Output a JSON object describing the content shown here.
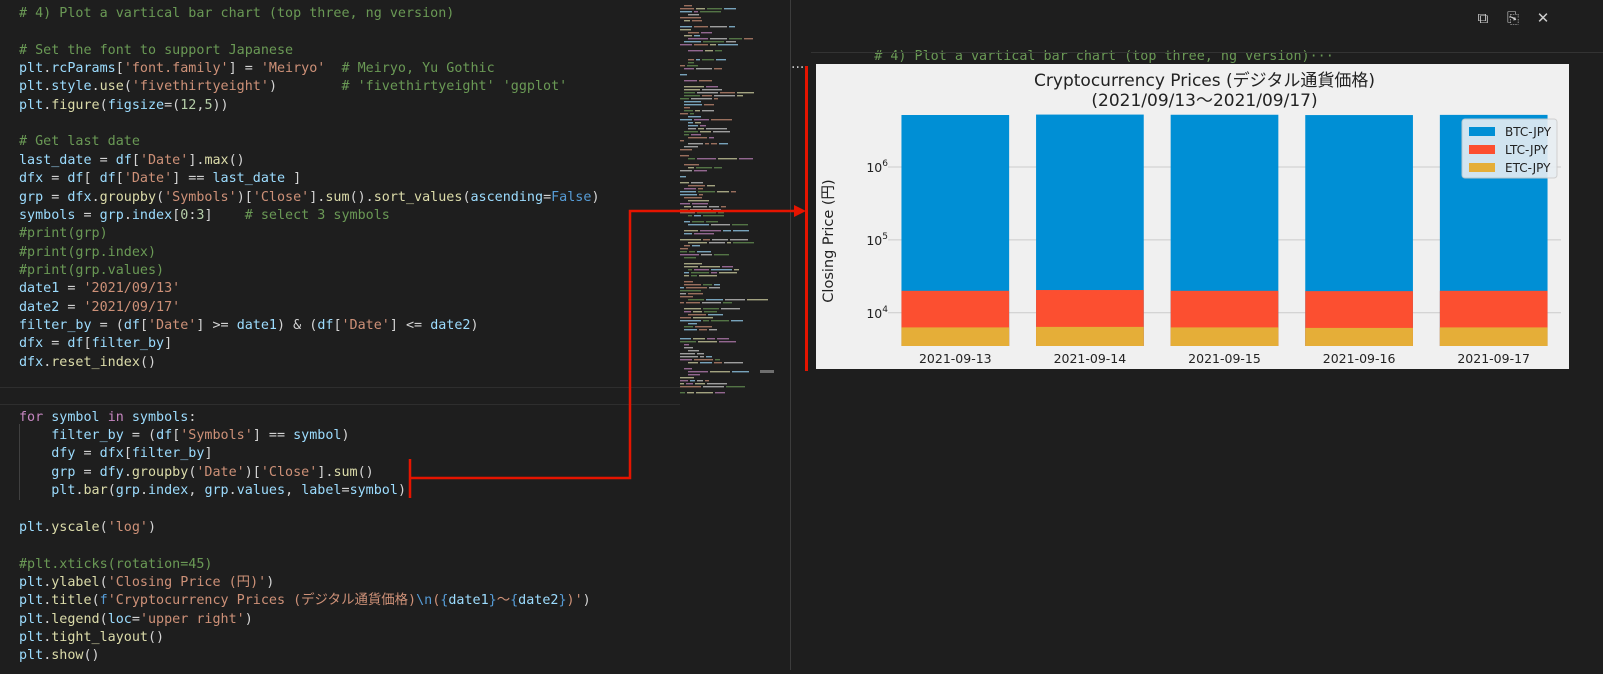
{
  "code_lines": [
    {
      "tokens": [
        {
          "t": "c",
          "x": "# 4) Plot a vartical bar chart (top three, ng version)"
        }
      ]
    },
    {
      "tokens": []
    },
    {
      "tokens": [
        {
          "t": "c",
          "x": "# Set the font to support Japanese"
        }
      ]
    },
    {
      "tokens": [
        {
          "t": "v",
          "x": "plt"
        },
        {
          "t": "p",
          "x": "."
        },
        {
          "t": "v",
          "x": "rcParams"
        },
        {
          "t": "p",
          "x": "["
        },
        {
          "t": "s",
          "x": "'font.family'"
        },
        {
          "t": "p",
          "x": "] = "
        },
        {
          "t": "s",
          "x": "'Meiryo'"
        },
        {
          "t": "p",
          "x": "  "
        },
        {
          "t": "c",
          "x": "# Meiryo, Yu Gothic"
        }
      ]
    },
    {
      "tokens": [
        {
          "t": "v",
          "x": "plt"
        },
        {
          "t": "p",
          "x": "."
        },
        {
          "t": "v",
          "x": "style"
        },
        {
          "t": "p",
          "x": "."
        },
        {
          "t": "f",
          "x": "use"
        },
        {
          "t": "p",
          "x": "("
        },
        {
          "t": "s",
          "x": "'fivethirtyeight'"
        },
        {
          "t": "p",
          "x": ")        "
        },
        {
          "t": "c",
          "x": "# 'fivethirtyeight' 'ggplot'"
        }
      ]
    },
    {
      "tokens": [
        {
          "t": "v",
          "x": "plt"
        },
        {
          "t": "p",
          "x": "."
        },
        {
          "t": "f",
          "x": "figure"
        },
        {
          "t": "p",
          "x": "("
        },
        {
          "t": "v",
          "x": "figsize"
        },
        {
          "t": "p",
          "x": "=("
        },
        {
          "t": "m",
          "x": "12"
        },
        {
          "t": "p",
          "x": ","
        },
        {
          "t": "m",
          "x": "5"
        },
        {
          "t": "p",
          "x": "))"
        }
      ]
    },
    {
      "tokens": []
    },
    {
      "tokens": [
        {
          "t": "c",
          "x": "# Get last date"
        }
      ]
    },
    {
      "tokens": [
        {
          "t": "v",
          "x": "last_date"
        },
        {
          "t": "p",
          "x": " = "
        },
        {
          "t": "v",
          "x": "df"
        },
        {
          "t": "p",
          "x": "["
        },
        {
          "t": "s",
          "x": "'Date'"
        },
        {
          "t": "p",
          "x": "]."
        },
        {
          "t": "f",
          "x": "max"
        },
        {
          "t": "p",
          "x": "()"
        }
      ]
    },
    {
      "tokens": [
        {
          "t": "v",
          "x": "dfx"
        },
        {
          "t": "p",
          "x": " = "
        },
        {
          "t": "v",
          "x": "df"
        },
        {
          "t": "p",
          "x": "[ "
        },
        {
          "t": "v",
          "x": "df"
        },
        {
          "t": "p",
          "x": "["
        },
        {
          "t": "s",
          "x": "'Date'"
        },
        {
          "t": "p",
          "x": "] == "
        },
        {
          "t": "v",
          "x": "last_date"
        },
        {
          "t": "p",
          "x": " ]"
        }
      ]
    },
    {
      "tokens": [
        {
          "t": "v",
          "x": "grp"
        },
        {
          "t": "p",
          "x": " = "
        },
        {
          "t": "v",
          "x": "dfx"
        },
        {
          "t": "p",
          "x": "."
        },
        {
          "t": "f",
          "x": "groupby"
        },
        {
          "t": "p",
          "x": "("
        },
        {
          "t": "s",
          "x": "'Symbols'"
        },
        {
          "t": "p",
          "x": ")["
        },
        {
          "t": "s",
          "x": "'Close'"
        },
        {
          "t": "p",
          "x": "]."
        },
        {
          "t": "f",
          "x": "sum"
        },
        {
          "t": "p",
          "x": "()."
        },
        {
          "t": "f",
          "x": "sort_values"
        },
        {
          "t": "p",
          "x": "("
        },
        {
          "t": "v",
          "x": "ascending"
        },
        {
          "t": "p",
          "x": "="
        },
        {
          "t": "n",
          "x": "False"
        },
        {
          "t": "p",
          "x": ")"
        }
      ]
    },
    {
      "tokens": [
        {
          "t": "v",
          "x": "symbols"
        },
        {
          "t": "p",
          "x": " = "
        },
        {
          "t": "v",
          "x": "grp"
        },
        {
          "t": "p",
          "x": "."
        },
        {
          "t": "v",
          "x": "index"
        },
        {
          "t": "p",
          "x": "["
        },
        {
          "t": "m",
          "x": "0"
        },
        {
          "t": "p",
          "x": ":"
        },
        {
          "t": "m",
          "x": "3"
        },
        {
          "t": "p",
          "x": "]    "
        },
        {
          "t": "c",
          "x": "# select 3 symbols"
        }
      ]
    },
    {
      "tokens": [
        {
          "t": "c",
          "x": "#print(grp)"
        }
      ]
    },
    {
      "tokens": [
        {
          "t": "c",
          "x": "#print(grp.index)"
        }
      ]
    },
    {
      "tokens": [
        {
          "t": "c",
          "x": "#print(grp.values)"
        }
      ]
    },
    {
      "tokens": [
        {
          "t": "v",
          "x": "date1"
        },
        {
          "t": "p",
          "x": " = "
        },
        {
          "t": "s",
          "x": "'2021/09/13'"
        }
      ]
    },
    {
      "tokens": [
        {
          "t": "v",
          "x": "date2"
        },
        {
          "t": "p",
          "x": " = "
        },
        {
          "t": "s",
          "x": "'2021/09/17'"
        }
      ]
    },
    {
      "tokens": [
        {
          "t": "v",
          "x": "filter_by"
        },
        {
          "t": "p",
          "x": " = ("
        },
        {
          "t": "v",
          "x": "df"
        },
        {
          "t": "p",
          "x": "["
        },
        {
          "t": "s",
          "x": "'Date'"
        },
        {
          "t": "p",
          "x": "] >= "
        },
        {
          "t": "v",
          "x": "date1"
        },
        {
          "t": "p",
          "x": ") & ("
        },
        {
          "t": "v",
          "x": "df"
        },
        {
          "t": "p",
          "x": "["
        },
        {
          "t": "s",
          "x": "'Date'"
        },
        {
          "t": "p",
          "x": "] <= "
        },
        {
          "t": "v",
          "x": "date2"
        },
        {
          "t": "p",
          "x": ")"
        }
      ]
    },
    {
      "tokens": [
        {
          "t": "v",
          "x": "dfx"
        },
        {
          "t": "p",
          "x": " = "
        },
        {
          "t": "v",
          "x": "df"
        },
        {
          "t": "p",
          "x": "["
        },
        {
          "t": "v",
          "x": "filter_by"
        },
        {
          "t": "p",
          "x": "]"
        }
      ]
    },
    {
      "tokens": [
        {
          "t": "v",
          "x": "dfx"
        },
        {
          "t": "p",
          "x": "."
        },
        {
          "t": "f",
          "x": "reset_index"
        },
        {
          "t": "p",
          "x": "()"
        }
      ]
    },
    {
      "tokens": []
    },
    {
      "tokens": []
    },
    {
      "tokens": [
        {
          "t": "k",
          "x": "for"
        },
        {
          "t": "p",
          "x": " "
        },
        {
          "t": "v",
          "x": "symbol"
        },
        {
          "t": "p",
          "x": " "
        },
        {
          "t": "k",
          "x": "in"
        },
        {
          "t": "p",
          "x": " "
        },
        {
          "t": "v",
          "x": "symbols"
        },
        {
          "t": "p",
          "x": ":"
        }
      ]
    },
    {
      "tokens": [
        {
          "t": "p",
          "x": "    "
        },
        {
          "t": "v",
          "x": "filter_by"
        },
        {
          "t": "p",
          "x": " = ("
        },
        {
          "t": "v",
          "x": "df"
        },
        {
          "t": "p",
          "x": "["
        },
        {
          "t": "s",
          "x": "'Symbols'"
        },
        {
          "t": "p",
          "x": "] == "
        },
        {
          "t": "v",
          "x": "symbol"
        },
        {
          "t": "p",
          "x": ")"
        }
      ]
    },
    {
      "tokens": [
        {
          "t": "p",
          "x": "    "
        },
        {
          "t": "v",
          "x": "dfy"
        },
        {
          "t": "p",
          "x": " = "
        },
        {
          "t": "v",
          "x": "dfx"
        },
        {
          "t": "p",
          "x": "["
        },
        {
          "t": "v",
          "x": "filter_by"
        },
        {
          "t": "p",
          "x": "]"
        }
      ]
    },
    {
      "tokens": [
        {
          "t": "p",
          "x": "    "
        },
        {
          "t": "v",
          "x": "grp"
        },
        {
          "t": "p",
          "x": " = "
        },
        {
          "t": "v",
          "x": "dfy"
        },
        {
          "t": "p",
          "x": "."
        },
        {
          "t": "f",
          "x": "groupby"
        },
        {
          "t": "p",
          "x": "("
        },
        {
          "t": "s",
          "x": "'Date'"
        },
        {
          "t": "p",
          "x": ")["
        },
        {
          "t": "s",
          "x": "'Close'"
        },
        {
          "t": "p",
          "x": "]."
        },
        {
          "t": "f",
          "x": "sum"
        },
        {
          "t": "p",
          "x": "()"
        }
      ]
    },
    {
      "tokens": [
        {
          "t": "p",
          "x": "    "
        },
        {
          "t": "v",
          "x": "plt"
        },
        {
          "t": "p",
          "x": "."
        },
        {
          "t": "f",
          "x": "bar"
        },
        {
          "t": "p",
          "x": "("
        },
        {
          "t": "v",
          "x": "grp"
        },
        {
          "t": "p",
          "x": "."
        },
        {
          "t": "v",
          "x": "index"
        },
        {
          "t": "p",
          "x": ", "
        },
        {
          "t": "v",
          "x": "grp"
        },
        {
          "t": "p",
          "x": "."
        },
        {
          "t": "v",
          "x": "values"
        },
        {
          "t": "p",
          "x": ", "
        },
        {
          "t": "v",
          "x": "label"
        },
        {
          "t": "p",
          "x": "="
        },
        {
          "t": "v",
          "x": "symbol"
        },
        {
          "t": "p",
          "x": ")"
        }
      ]
    },
    {
      "tokens": []
    },
    {
      "tokens": [
        {
          "t": "v",
          "x": "plt"
        },
        {
          "t": "p",
          "x": "."
        },
        {
          "t": "f",
          "x": "yscale"
        },
        {
          "t": "p",
          "x": "("
        },
        {
          "t": "s",
          "x": "'log'"
        },
        {
          "t": "p",
          "x": ")"
        }
      ]
    },
    {
      "tokens": []
    },
    {
      "tokens": [
        {
          "t": "c",
          "x": "#plt.xticks(rotation=45)"
        }
      ]
    },
    {
      "tokens": [
        {
          "t": "v",
          "x": "plt"
        },
        {
          "t": "p",
          "x": "."
        },
        {
          "t": "f",
          "x": "ylabel"
        },
        {
          "t": "p",
          "x": "("
        },
        {
          "t": "s",
          "x": "'Closing Price (円)'"
        },
        {
          "t": "p",
          "x": ")"
        }
      ]
    },
    {
      "tokens": [
        {
          "t": "v",
          "x": "plt"
        },
        {
          "t": "p",
          "x": "."
        },
        {
          "t": "f",
          "x": "title"
        },
        {
          "t": "p",
          "x": "("
        },
        {
          "t": "n",
          "x": "f"
        },
        {
          "t": "s",
          "x": "'Cryptocurrency Prices (デジタル通貨価格)"
        },
        {
          "t": "n",
          "x": "\\n"
        },
        {
          "t": "s",
          "x": "("
        },
        {
          "t": "n",
          "x": "{"
        },
        {
          "t": "v",
          "x": "date1"
        },
        {
          "t": "n",
          "x": "}"
        },
        {
          "t": "s",
          "x": "〜"
        },
        {
          "t": "n",
          "x": "{"
        },
        {
          "t": "v",
          "x": "date2"
        },
        {
          "t": "n",
          "x": "}"
        },
        {
          "t": "s",
          "x": ")'"
        },
        {
          "t": "p",
          "x": ")"
        }
      ]
    },
    {
      "tokens": [
        {
          "t": "v",
          "x": "plt"
        },
        {
          "t": "p",
          "x": "."
        },
        {
          "t": "f",
          "x": "legend"
        },
        {
          "t": "p",
          "x": "("
        },
        {
          "t": "v",
          "x": "loc"
        },
        {
          "t": "p",
          "x": "="
        },
        {
          "t": "s",
          "x": "'upper right'"
        },
        {
          "t": "p",
          "x": ")"
        }
      ]
    },
    {
      "tokens": [
        {
          "t": "v",
          "x": "plt"
        },
        {
          "t": "p",
          "x": "."
        },
        {
          "t": "f",
          "x": "tight_layout"
        },
        {
          "t": "p",
          "x": "()"
        }
      ]
    },
    {
      "tokens": [
        {
          "t": "v",
          "x": "plt"
        },
        {
          "t": "p",
          "x": "."
        },
        {
          "t": "f",
          "x": "show"
        },
        {
          "t": "p",
          "x": "()"
        }
      ]
    }
  ],
  "colors": {
    "comment": "#6a9955",
    "string": "#ce9178",
    "keyword": "#c586c0",
    "builtin": "#569cd6",
    "variable": "#9cdcfe",
    "function": "#dcdcaa",
    "number": "#b5cea8",
    "plain": "#d4d4d4",
    "annotation": "#e51400"
  },
  "toolbar": {
    "copy_icon": "copy-icon",
    "paste_icon": "paste-icon",
    "close_label": "✕"
  },
  "output": {
    "comment": "# 4) Plot a vartical bar chart (top three, ng version)",
    "ellipsis": "···",
    "more": "···"
  },
  "chart_data": {
    "type": "bar",
    "stacked_overlay": true,
    "title": "Cryptocurrency Prices (デジタル通貨価格)",
    "subtitle": "(2021/09/13〜2021/09/17)",
    "xlabel": "",
    "ylabel": "Closing Price (円)",
    "yscale": "log",
    "ylim": [
      3500,
      5000000
    ],
    "yticks": [
      {
        "v": 10000,
        "base": "10",
        "exp": "4"
      },
      {
        "v": 100000,
        "base": "10",
        "exp": "5"
      },
      {
        "v": 1000000,
        "base": "10",
        "exp": "6"
      }
    ],
    "categories": [
      "2021-09-13",
      "2021-09-14",
      "2021-09-15",
      "2021-09-16",
      "2021-09-17"
    ],
    "series": [
      {
        "name": "BTC-JPY",
        "color": "#008fd5",
        "values": [
          5160000,
          5230000,
          5200000,
          5150000,
          5180000
        ]
      },
      {
        "name": "LTC-JPY",
        "color": "#fc4f30",
        "values": [
          20000,
          20500,
          20000,
          19800,
          20000
        ]
      },
      {
        "name": "ETC-JPY",
        "color": "#e5ae38",
        "values": [
          6300,
          6400,
          6300,
          6200,
          6300
        ]
      }
    ],
    "legend": "top-right",
    "grid": true
  }
}
